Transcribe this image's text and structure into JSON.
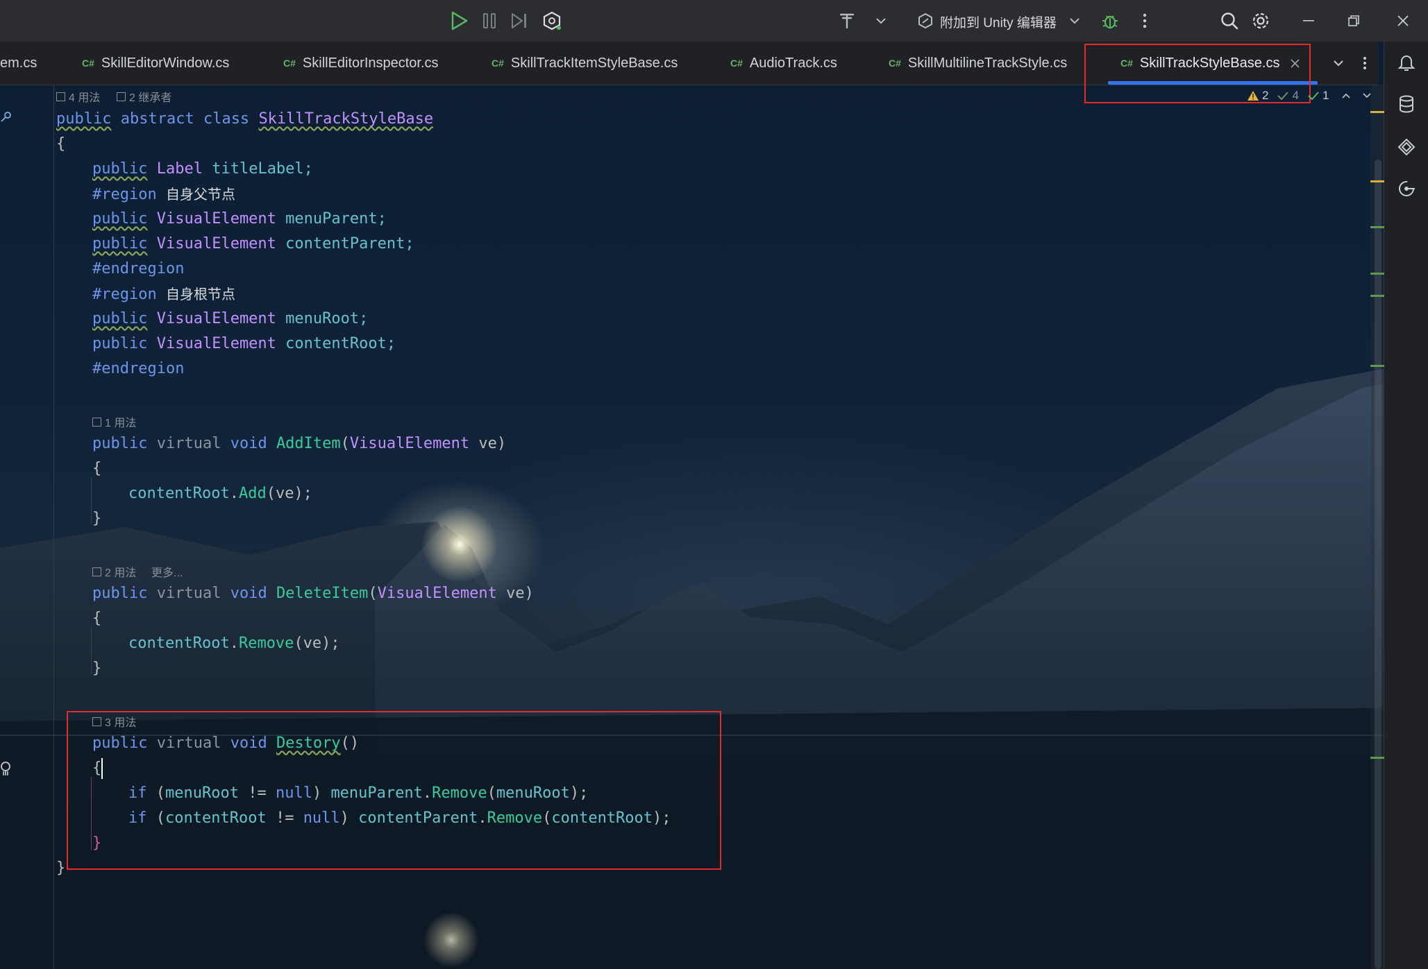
{
  "toolbar": {
    "attach_label": "附加到 Unity 编辑器",
    "icons": [
      "run-icon",
      "pause-icon",
      "step-icon",
      "unity-icon",
      "build-icon",
      "chevron-down-icon",
      "attach-icon",
      "debug-icon",
      "more-icon",
      "search-icon",
      "gear-icon",
      "minimize-icon",
      "restore-icon",
      "close-icon"
    ]
  },
  "tabs": [
    {
      "label": "em.cs",
      "lang": ""
    },
    {
      "label": "SkillEditorWindow.cs",
      "lang": "C#"
    },
    {
      "label": "SkillEditorInspector.cs",
      "lang": "C#"
    },
    {
      "label": "SkillTrackItemStyleBase.cs",
      "lang": "C#"
    },
    {
      "label": "AudioTrack.cs",
      "lang": "C#"
    },
    {
      "label": "SkillMultilineTrackStyle.cs",
      "lang": "C#"
    },
    {
      "label": "SkillTrackStyleBase.cs",
      "lang": "C#",
      "active": true
    }
  ],
  "inspections": {
    "warnings": "2",
    "weak": "4",
    "ok": "1"
  },
  "hints": {
    "class_usages": "4 用法",
    "class_inheritors": "2 继承者",
    "additem_usages": "1 用法",
    "deleteitem_usages": "2 用法",
    "deleteitem_more": "更多...",
    "destory_usages": "3 用法"
  },
  "code": {
    "l1_public": "public",
    "l1_abstract": "abstract",
    "l1_class": "class",
    "l1_name": "SkillTrackStyleBase",
    "brace_open": "{",
    "brace_close": "}",
    "l3_public": "public",
    "l3_type": "Label",
    "l3_name": "titleLabel;",
    "region1": "#region",
    "region1_text": "自身父节点",
    "l5_public": "public",
    "l5_type": "VisualElement",
    "l5_name": "menuParent;",
    "l6_public": "public",
    "l6_type": "VisualElement",
    "l6_name": "contentParent;",
    "endregion": "#endregion",
    "region2": "#region",
    "region2_text": "自身根节点",
    "l9_public": "public",
    "l9_type": "VisualElement",
    "l9_name": "menuRoot;",
    "l10_public": "public",
    "l10_type": "VisualElement",
    "l10_name": "contentRoot;",
    "m1_public": "public",
    "m1_virtual": "virtual",
    "m1_void": "void",
    "m1_name": "AddItem",
    "m1_paren": "(",
    "m1_ptype": "VisualElement",
    "m1_param": " ve)",
    "m1_body_obj": "contentRoot",
    "m1_body_dot": ".",
    "m1_body_fn": "Add",
    "m1_body_args": "(ve);",
    "m2_public": "public",
    "m2_virtual": "virtual",
    "m2_void": "void",
    "m2_name": "DeleteItem",
    "m2_paren": "(",
    "m2_ptype": "VisualElement",
    "m2_param": " ve)",
    "m2_body_obj": "contentRoot",
    "m2_body_dot": ".",
    "m2_body_fn": "Remove",
    "m2_body_args": "(ve);",
    "m3_public": "public",
    "m3_virtual": "virtual",
    "m3_void": "void",
    "m3_name": "Destory",
    "m3_parens": "()",
    "s1_if": "if",
    "s1_open": " (",
    "s1_var": "menuRoot",
    "s1_ne": " != ",
    "s1_null": "null",
    "s1_close": ") ",
    "s1_obj": "menuParent",
    "s1_dot": ".",
    "s1_fn": "Remove",
    "s1_args_open": "(",
    "s1_arg": "menuRoot",
    "s1_args_close": ");",
    "s2_if": "if",
    "s2_open": " (",
    "s2_var": "contentRoot",
    "s2_ne": " != ",
    "s2_null": "null",
    "s2_close": ") ",
    "s2_obj": "contentParent",
    "s2_dot": ".",
    "s2_fn": "Remove",
    "s2_args_open": "(",
    "s2_arg": "contentRoot",
    "s2_args_close": ");"
  },
  "colors": {
    "accent": "#3574f0",
    "highlight_box": "#e02c2c",
    "keyword": "#6c95eb",
    "type": "#c191ff",
    "method": "#39cc9b",
    "field": "#66c3cc",
    "region": "#85c46c"
  }
}
